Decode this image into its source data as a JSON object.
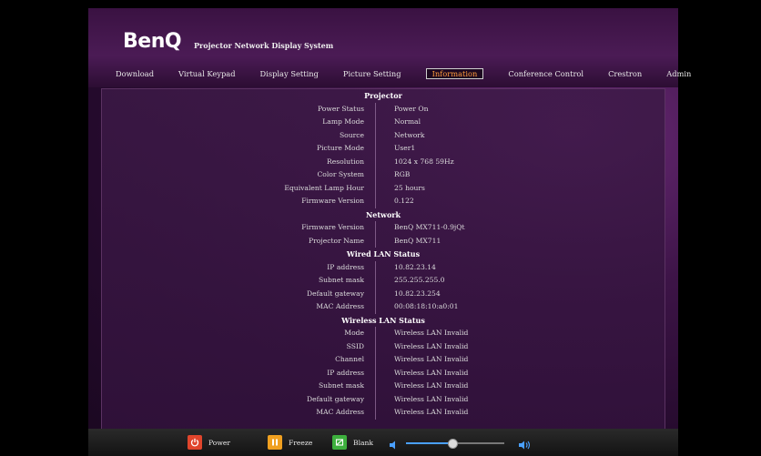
{
  "header": {
    "logo": "BenQ",
    "title": "Projector Network Display System"
  },
  "nav": [
    {
      "label": "Download",
      "active": false
    },
    {
      "label": "Virtual Keypad",
      "active": false
    },
    {
      "label": "Display Setting",
      "active": false
    },
    {
      "label": "Picture Setting",
      "active": false
    },
    {
      "label": "Information",
      "active": true
    },
    {
      "label": "Conference Control",
      "active": false
    },
    {
      "label": "Crestron",
      "active": false
    },
    {
      "label": "Admin",
      "active": false
    }
  ],
  "sections": [
    {
      "title": "Projector",
      "rows": [
        {
          "label": "Power Status",
          "value": "Power On"
        },
        {
          "label": "Lamp Mode",
          "value": "Normal"
        },
        {
          "label": "Source",
          "value": "Network"
        },
        {
          "label": "Picture Mode",
          "value": "User1"
        },
        {
          "label": "Resolution",
          "value": "1024 x 768 59Hz"
        },
        {
          "label": "Color System",
          "value": "RGB"
        },
        {
          "label": "Equivalent Lamp Hour",
          "value": "25 hours"
        },
        {
          "label": "Firmware Version",
          "value": "0.122"
        }
      ]
    },
    {
      "title": "Network",
      "rows": [
        {
          "label": "Firmware Version",
          "value": "BenQ MX711-0.9jQt"
        },
        {
          "label": "Projector Name",
          "value": "BenQ MX711"
        }
      ]
    },
    {
      "title": "Wired LAN Status",
      "rows": [
        {
          "label": "IP address",
          "value": "10.82.23.14"
        },
        {
          "label": "Subnet mask",
          "value": "255.255.255.0"
        },
        {
          "label": "Default gateway",
          "value": "10.82.23.254"
        },
        {
          "label": "MAC Address",
          "value": "00:08:18:10:a0:01"
        }
      ]
    },
    {
      "title": "Wireless LAN Status",
      "rows": [
        {
          "label": "Mode",
          "value": "Wireless LAN Invalid"
        },
        {
          "label": "SSID",
          "value": "Wireless LAN Invalid"
        },
        {
          "label": "Channel",
          "value": "Wireless LAN Invalid"
        },
        {
          "label": "IP address",
          "value": "Wireless LAN Invalid"
        },
        {
          "label": "Subnet mask",
          "value": "Wireless LAN Invalid"
        },
        {
          "label": "Default gateway",
          "value": "Wireless LAN Invalid"
        },
        {
          "label": "MAC Address",
          "value": "Wireless LAN Invalid"
        }
      ]
    }
  ],
  "controls": {
    "power": {
      "label": "Power",
      "icon": "power-icon",
      "color": "#e0452c"
    },
    "freeze": {
      "label": "Freeze",
      "icon": "pause-icon",
      "color": "#f0a020"
    },
    "blank": {
      "label": "Blank",
      "icon": "blank-icon",
      "color": "#3db03d"
    },
    "volume": {
      "level": 0.47,
      "low_icon": "speaker-low-icon",
      "high_icon": "speaker-high-icon"
    }
  },
  "colors": {
    "accent": "#ff9b3c",
    "volume": "#4aa0ff"
  }
}
